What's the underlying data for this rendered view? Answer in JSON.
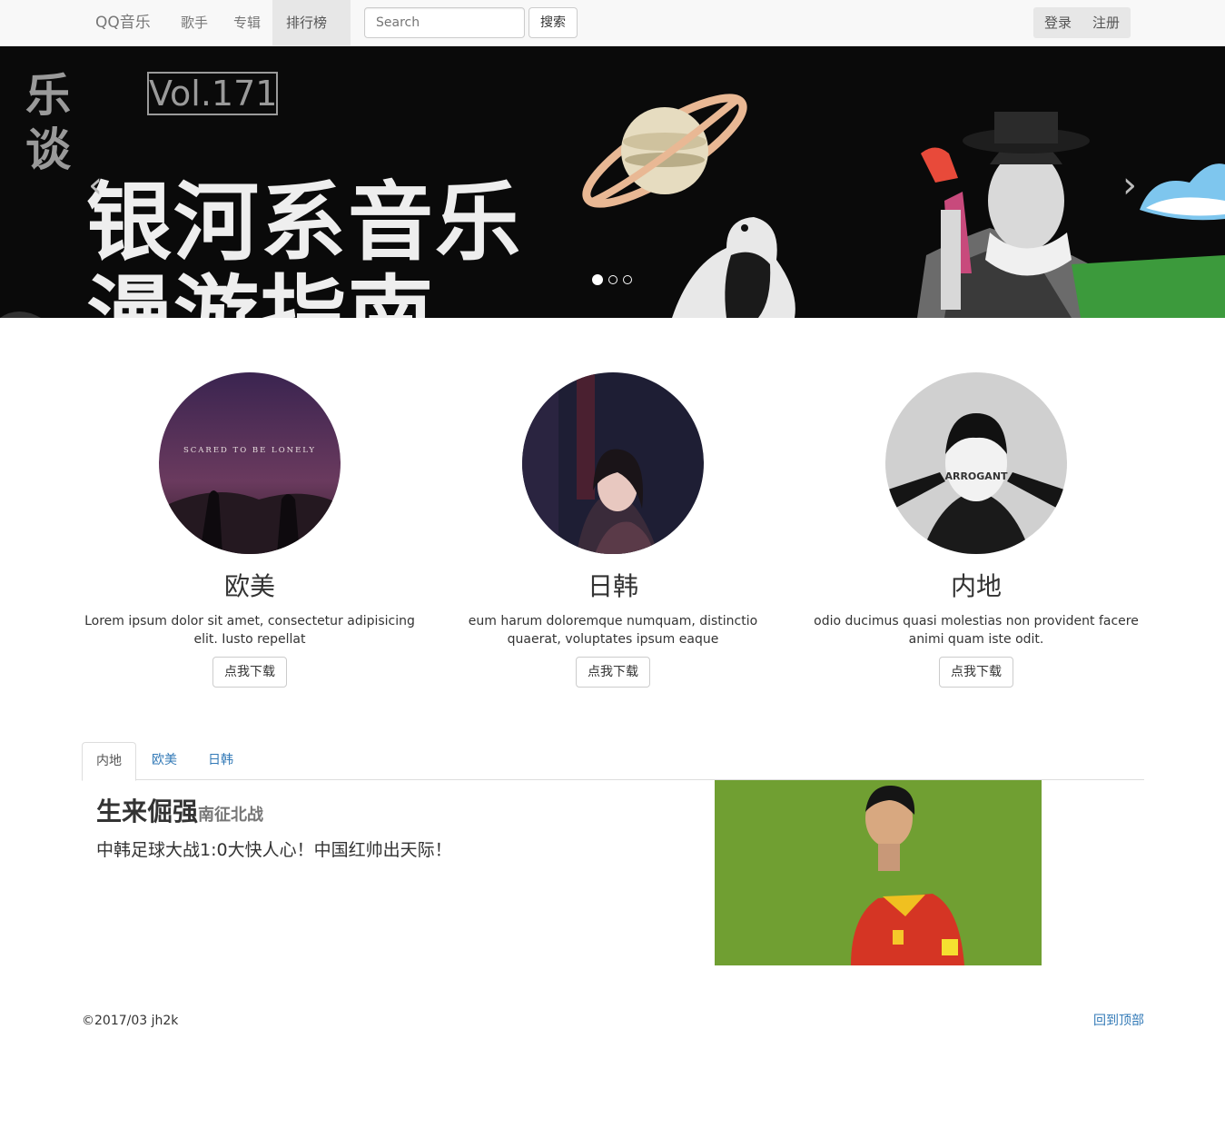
{
  "navbar": {
    "brand": "QQ音乐",
    "links": [
      "歌手",
      "专辑"
    ],
    "dropdown_label": "排行榜",
    "search_placeholder": "Search",
    "search_button": "搜索",
    "login": "登录",
    "register": "注册"
  },
  "carousel": {
    "logo_text": "乐谈",
    "vol": "Vol.171",
    "title_line1": "银河系音乐",
    "title_line2": "漫游指南",
    "prev_icon": "‹",
    "next_icon": "›",
    "indicator_count": 3,
    "active_index": 0
  },
  "features": [
    {
      "title": "欧美",
      "desc": "Lorem ipsum dolor sit amet, consectetur adipisicing elit. Iusto repellat",
      "button": "点我下载",
      "cover_text": "SCARED TO BE LONELY"
    },
    {
      "title": "日韩",
      "desc": "eum harum doloremque numquam, distinctio quaerat, voluptates ipsum eaque",
      "button": "点我下载"
    },
    {
      "title": "内地",
      "desc": "odio ducimus quasi molestias non provident facere animi quam iste odit.",
      "button": "点我下载",
      "cover_text": "ARROGANT"
    }
  ],
  "tabs": [
    "内地",
    "欧美",
    "日韩"
  ],
  "active_tab": 0,
  "article": {
    "title": "生来倔强",
    "subtitle": "南征北战",
    "lead": "中韩足球大战1:0大快人心！中国红帅出天际！"
  },
  "footer": {
    "copyright": "©2017/03 jh2k",
    "back_to_top": "回到顶部"
  }
}
